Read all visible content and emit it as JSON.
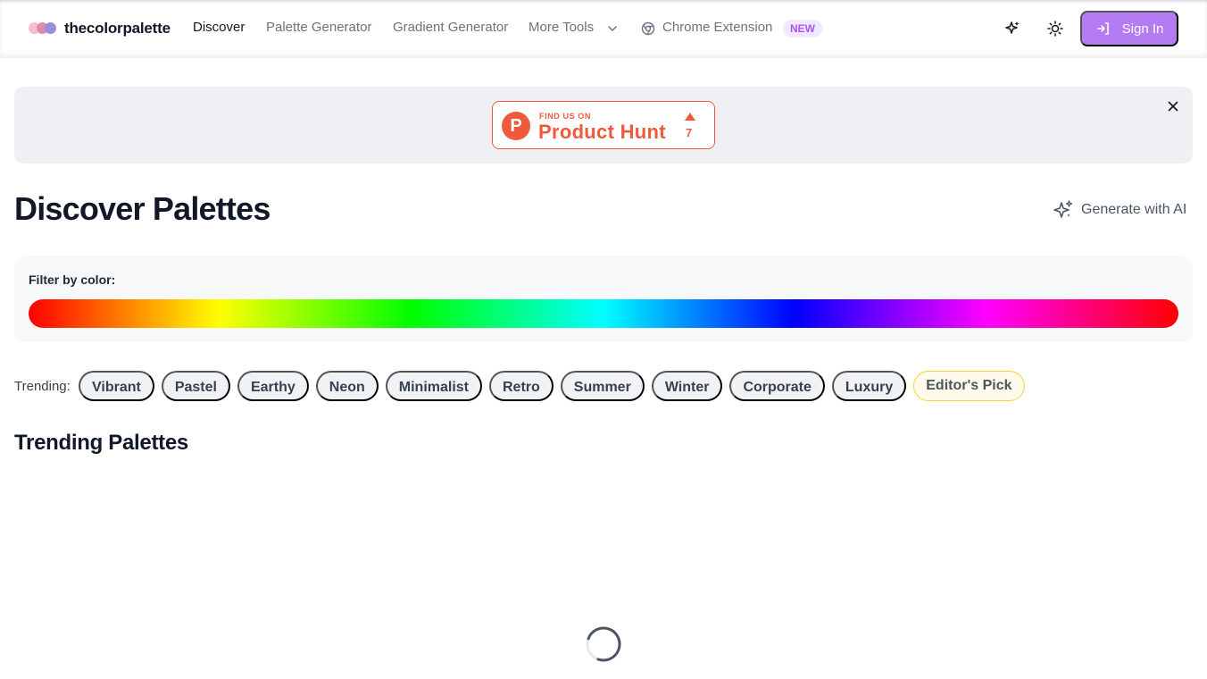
{
  "app": {
    "name": "thecolorpalette"
  },
  "logo": {
    "dot_colors": [
      "#f4b6c2",
      "#e48aa6",
      "#9b8ce0"
    ]
  },
  "nav": {
    "items": [
      {
        "label": "Discover"
      },
      {
        "label": "Palette Generator"
      },
      {
        "label": "Gradient Generator"
      },
      {
        "label": "More Tools"
      },
      {
        "label": "Chrome Extension"
      }
    ],
    "new_badge": "NEW"
  },
  "header": {
    "sign_in_label": "Sign In",
    "accent": "#b57bf2"
  },
  "banner": {
    "find_us_label": "FIND US ON",
    "brand_label": "Product Hunt",
    "upvote_count": "7",
    "accent": "#ef5a3c"
  },
  "page": {
    "title": "Discover Palettes",
    "generate_ai_label": "Generate with AI"
  },
  "filter": {
    "label": "Filter by color:"
  },
  "trending": {
    "label": "Trending:",
    "tags": [
      {
        "label": "Vibrant"
      },
      {
        "label": "Pastel"
      },
      {
        "label": "Earthy"
      },
      {
        "label": "Neon"
      },
      {
        "label": "Minimalist"
      },
      {
        "label": "Retro"
      },
      {
        "label": "Summer"
      },
      {
        "label": "Winter"
      },
      {
        "label": "Corporate"
      },
      {
        "label": "Luxury"
      },
      {
        "label": "Editor's Pick"
      }
    ]
  },
  "section": {
    "title": "Trending Palettes"
  },
  "icons": {
    "more_tools": "chevron-down-icon",
    "chrome": "chrome-icon",
    "ai_header": "sparkles-icon",
    "theme": "sun-icon",
    "sign_in": "login-icon",
    "banner_close": "close-icon",
    "generate_ai": "sparkles-icon",
    "loading": "spinner-icon"
  }
}
